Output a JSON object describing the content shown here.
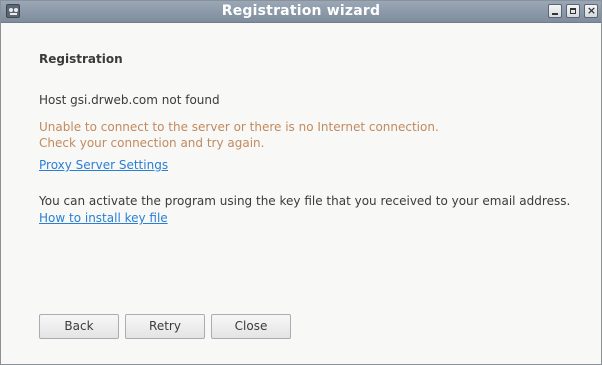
{
  "window": {
    "title": "Registration wizard",
    "controls": {
      "minimize_icon": "minimize-icon",
      "maximize_icon": "maximize-icon",
      "close_icon": "close-icon",
      "close_glyph": "×"
    }
  },
  "page": {
    "heading": "Registration",
    "host_message": "Host gsi.drweb.com not found",
    "warning_line1": "Unable to connect to the server or there is no Internet connection.",
    "warning_line2": "Check your connection and try again.",
    "proxy_link": "Proxy Server Settings",
    "key_message": "You can activate the program using the key file that you received to your email address.",
    "key_link": "How to install key file"
  },
  "buttons": {
    "back": "Back",
    "retry": "Retry",
    "close": "Close"
  },
  "colors": {
    "titlebar": "#8a97a7",
    "warning_text": "#c28a5e",
    "link": "#2a7fd4",
    "background": "#f8f8f7"
  }
}
